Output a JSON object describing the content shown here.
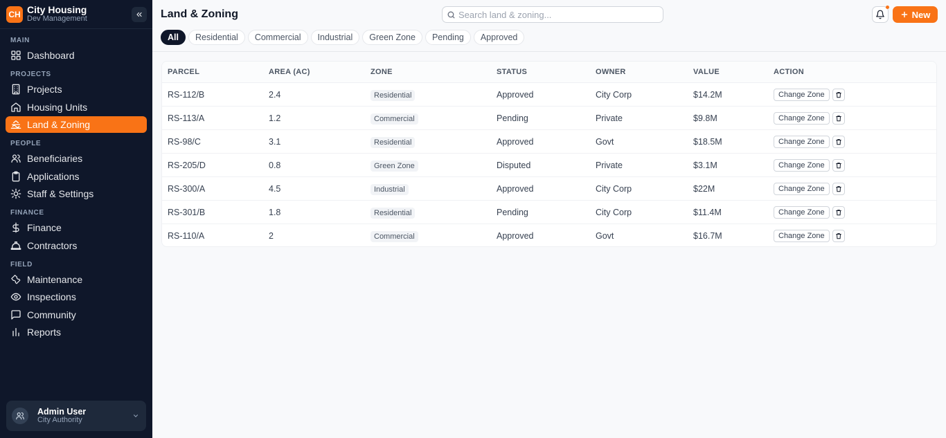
{
  "brand": {
    "logo": "CH",
    "title": "City Housing",
    "subtitle": "Dev Management"
  },
  "sidebar": {
    "sections": [
      {
        "label": "MAIN",
        "items": [
          {
            "label": "Dashboard",
            "icon": "grid-icon"
          }
        ]
      },
      {
        "label": "PROJECTS",
        "items": [
          {
            "label": "Projects",
            "icon": "building-icon"
          },
          {
            "label": "Housing Units",
            "icon": "home-icon"
          },
          {
            "label": "Land & Zoning",
            "icon": "landscape-icon",
            "active": true
          }
        ]
      },
      {
        "label": "PEOPLE",
        "items": [
          {
            "label": "Beneficiaries",
            "icon": "users-icon"
          },
          {
            "label": "Applications",
            "icon": "clipboard-icon"
          },
          {
            "label": "Staff & Settings",
            "icon": "settings-icon"
          }
        ]
      },
      {
        "label": "FINANCE",
        "items": [
          {
            "label": "Finance",
            "icon": "dollar-icon"
          },
          {
            "label": "Contractors",
            "icon": "hardhat-icon"
          }
        ]
      },
      {
        "label": "FIELD",
        "items": [
          {
            "label": "Maintenance",
            "icon": "wrench-icon"
          },
          {
            "label": "Inspections",
            "icon": "eye-icon"
          },
          {
            "label": "Community",
            "icon": "message-icon"
          },
          {
            "label": "Reports",
            "icon": "bar-chart-icon"
          }
        ]
      }
    ]
  },
  "user": {
    "name": "Admin User",
    "role": "City Authority"
  },
  "header": {
    "title": "Land & Zoning",
    "search_placeholder": "Search land & zoning...",
    "new_label": "New"
  },
  "filters": [
    "All",
    "Residential",
    "Commercial",
    "Industrial",
    "Green Zone",
    "Pending",
    "Approved"
  ],
  "table": {
    "columns": [
      "PARCEL",
      "AREA (AC)",
      "ZONE",
      "STATUS",
      "OWNER",
      "VALUE",
      "ACTION"
    ],
    "action_label": "Change Zone",
    "rows": [
      {
        "parcel": "RS-112/B",
        "area": "2.4",
        "zone": "Residential",
        "status": "Approved",
        "owner": "City Corp",
        "value": "$14.2M"
      },
      {
        "parcel": "RS-113/A",
        "area": "1.2",
        "zone": "Commercial",
        "status": "Pending",
        "owner": "Private",
        "value": "$9.8M"
      },
      {
        "parcel": "RS-98/C",
        "area": "3.1",
        "zone": "Residential",
        "status": "Approved",
        "owner": "Govt",
        "value": "$18.5M"
      },
      {
        "parcel": "RS-205/D",
        "area": "0.8",
        "zone": "Green Zone",
        "status": "Disputed",
        "owner": "Private",
        "value": "$3.1M"
      },
      {
        "parcel": "RS-300/A",
        "area": "4.5",
        "zone": "Industrial",
        "status": "Approved",
        "owner": "City Corp",
        "value": "$22M"
      },
      {
        "parcel": "RS-301/B",
        "area": "1.8",
        "zone": "Residential",
        "status": "Pending",
        "owner": "City Corp",
        "value": "$11.4M"
      },
      {
        "parcel": "RS-110/A",
        "area": "2",
        "zone": "Commercial",
        "status": "Approved",
        "owner": "Govt",
        "value": "$16.7M"
      }
    ]
  },
  "colors": {
    "accent": "#f97316",
    "sidebar_bg": "#0f172a"
  }
}
